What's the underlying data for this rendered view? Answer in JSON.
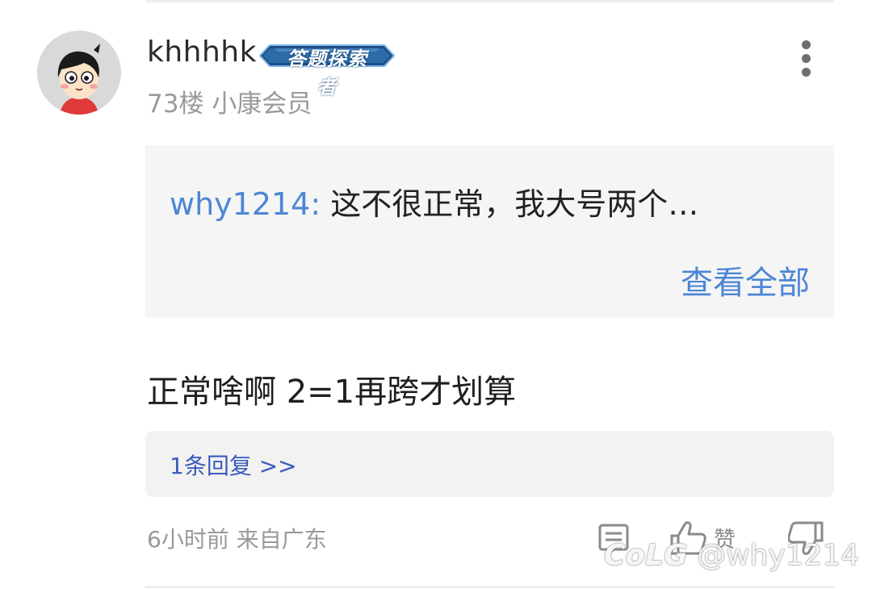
{
  "post": {
    "username": "khhhhk",
    "badge": "答题探索者",
    "floor": "73楼",
    "member_level": "小康会员",
    "quote": {
      "user": "why1214:",
      "text": "这不很正常，我大号两个…",
      "view_all": "查看全部"
    },
    "content": "正常啥啊 2=1再跨才划算",
    "replies_link": "1条回复 >>",
    "time_location": "6小时前 来自广东",
    "actions": {
      "like_label": "赞"
    }
  },
  "watermark": {
    "logo": "CoLG",
    "handle": "@why1214"
  },
  "colors": {
    "link_blue": "#4d86d6",
    "reply_blue": "#3a5bbd",
    "quote_bg": "#f5f5f5",
    "meta_gray": "#9a9a9a"
  },
  "icons": [
    "more-vertical-icon",
    "comment-icon",
    "thumbs-up-icon",
    "thumbs-down-icon"
  ]
}
